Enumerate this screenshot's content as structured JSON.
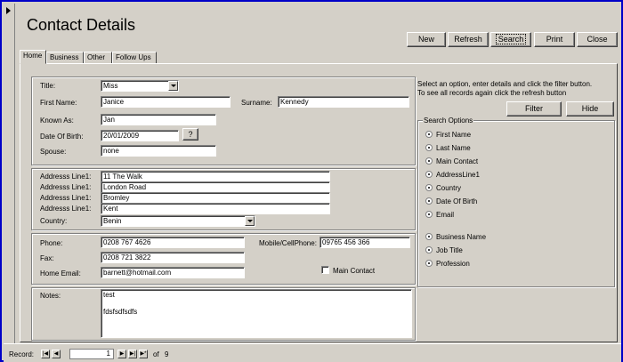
{
  "form": {
    "title": "Contact Details"
  },
  "toolbar": {
    "new": "New",
    "refresh": "Refresh",
    "search": "Search",
    "print": "Print",
    "close": "Close"
  },
  "tabs": [
    "Home",
    "Business",
    "Other",
    "Follow Ups"
  ],
  "personal": {
    "title_label": "Title:",
    "title_value": "Miss",
    "first_name_label": "First Name:",
    "first_name_value": "Janice",
    "surname_label": "Surname:",
    "surname_value": "Kennedy",
    "known_as_label": "Known As:",
    "known_as_value": "Jan",
    "dob_label": "Date Of Birth:",
    "dob_value": "20/01/2009",
    "dob_button": "?",
    "spouse_label": "Spouse:",
    "spouse_value": "none"
  },
  "address": {
    "line_label": "Addresss Line1:",
    "lines": [
      "11 The Walk",
      "London Road",
      "Bromley",
      "Kent"
    ],
    "country_label": "Country:",
    "country_value": "Benin"
  },
  "contact": {
    "phone_label": "Phone:",
    "phone_value": "0208 767 4626",
    "mobile_label": "Mobile/CellPhone:",
    "mobile_value": "09765 456 366",
    "fax_label": "Fax:",
    "fax_value": "0208 721 3822",
    "email_label": "Home Email:",
    "email_value": "barnett@hotmail.com",
    "main_contact_label": "Main Contact"
  },
  "notes": {
    "label": "Notes:",
    "line1": "test",
    "line2": "fdsfsdfsdfs"
  },
  "filter": {
    "instructions1": "Select an option, enter details and click the filter button.",
    "instructions2": "To see all records again click the refresh button",
    "filter_button": "Filter",
    "hide_button": "Hide",
    "group_label": "Search Options",
    "options_a": [
      "First Name",
      "Last Name",
      "Main Contact",
      "AddressLine1",
      "Country",
      "Date Of Birth",
      "Email"
    ],
    "options_b": [
      "Business Name",
      "Job Title",
      "Profession"
    ]
  },
  "nav": {
    "record_label": "Record:",
    "current": "1",
    "of_text": "of",
    "total": "9"
  }
}
